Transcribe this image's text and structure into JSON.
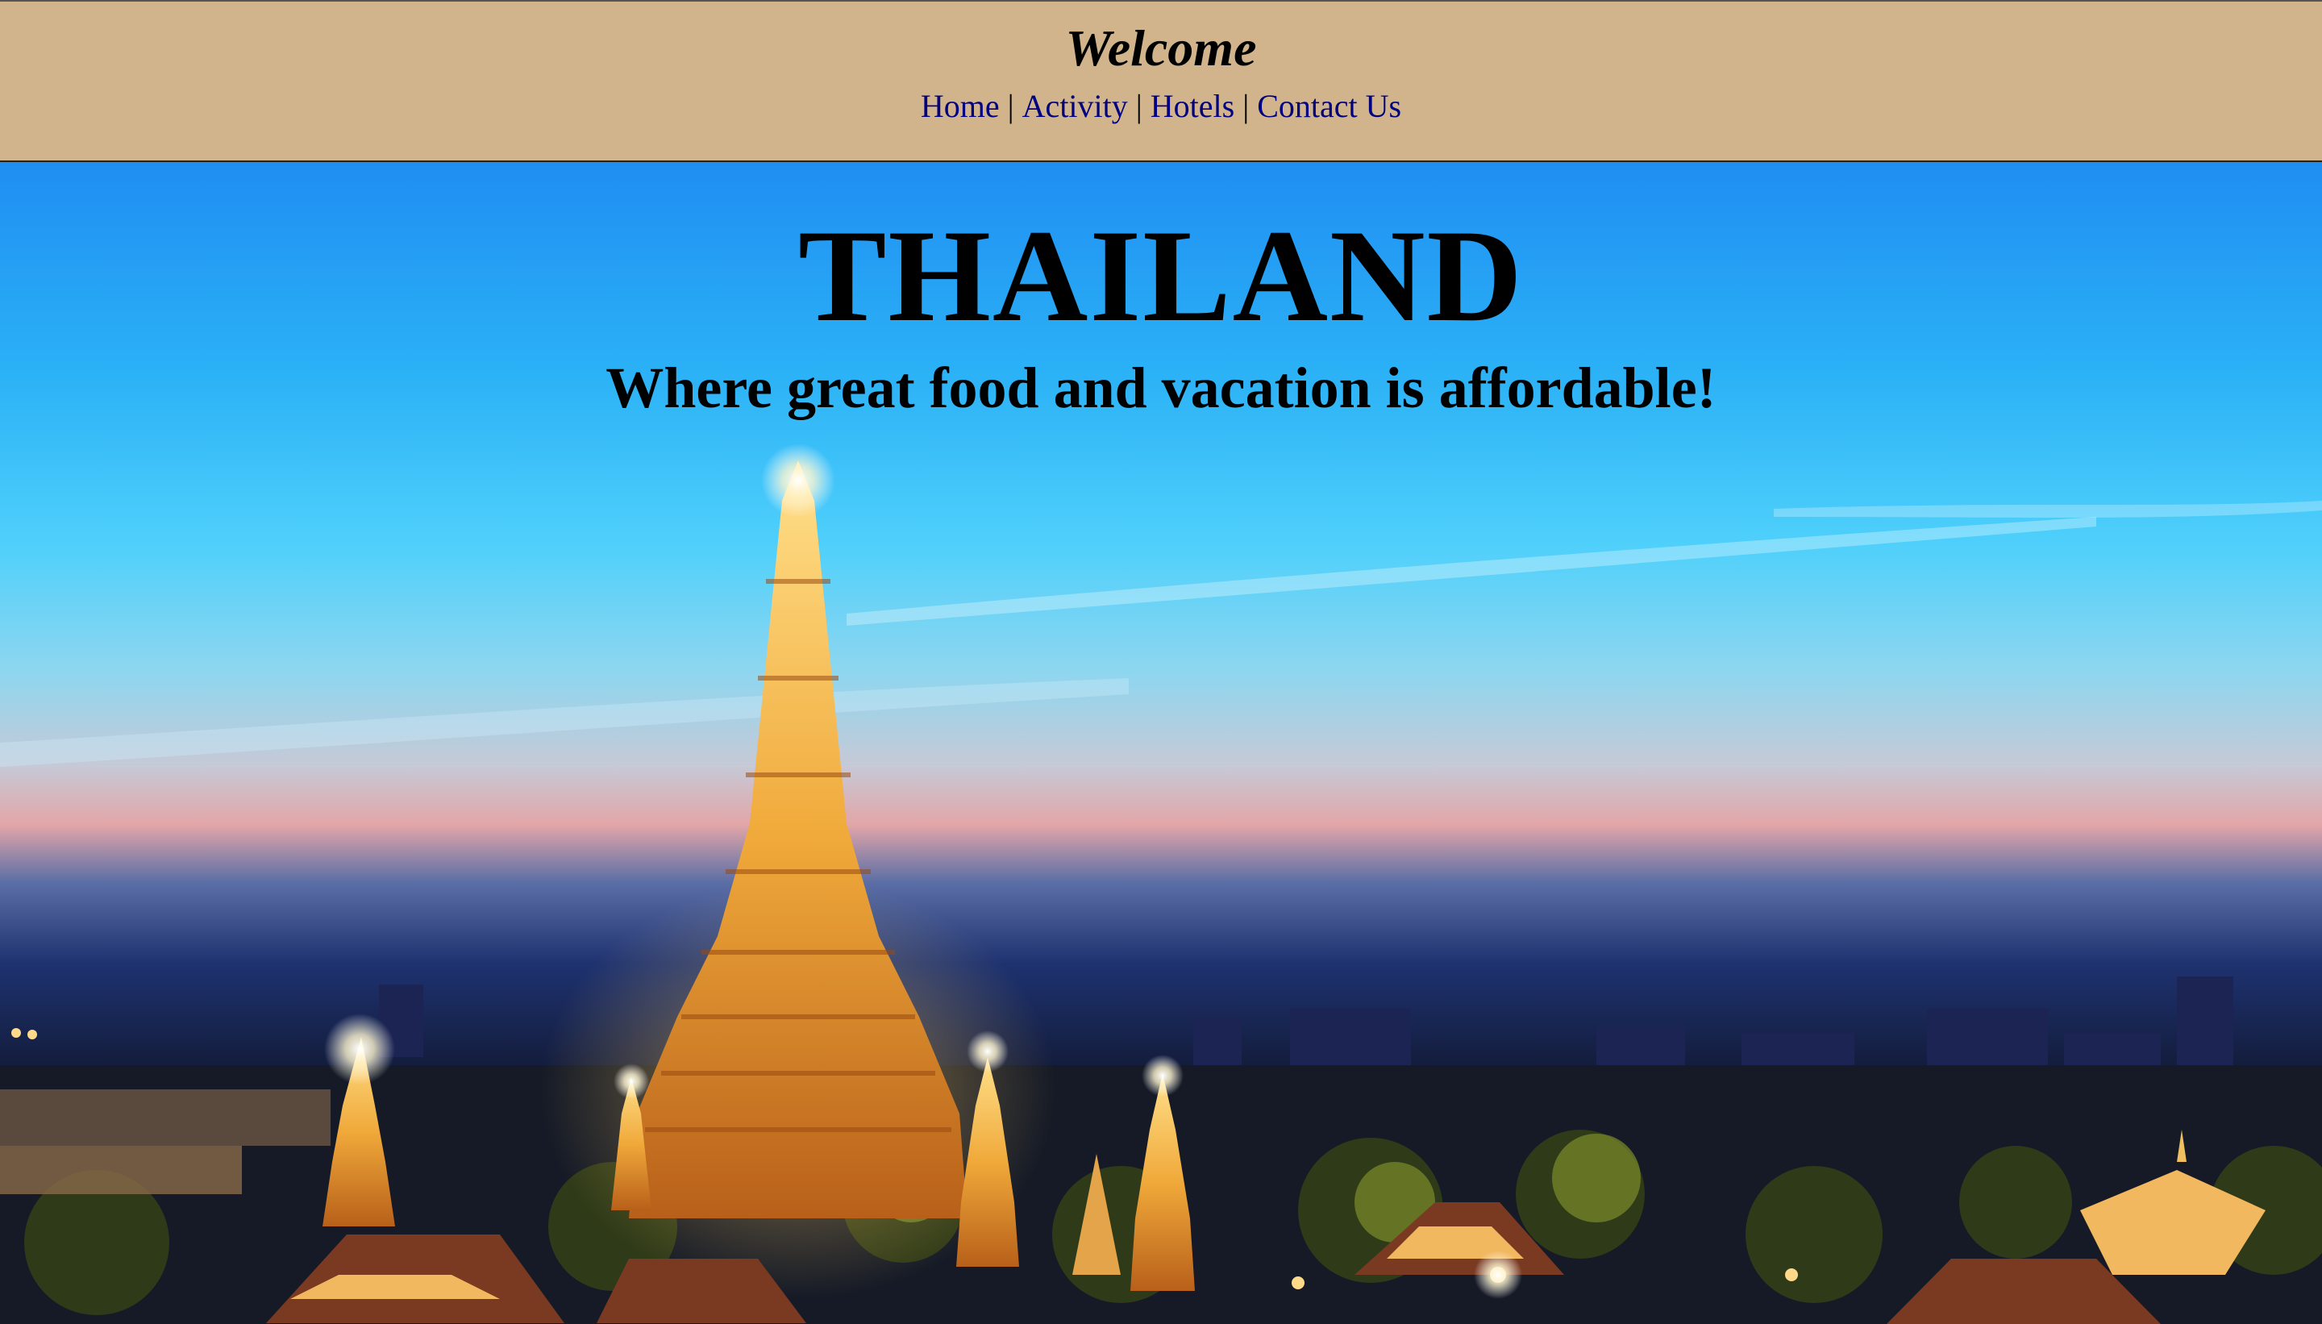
{
  "header": {
    "welcome": "Welcome",
    "nav": [
      {
        "label": "Home"
      },
      {
        "label": "Activity"
      },
      {
        "label": "Hotels"
      },
      {
        "label": "Contact Us"
      }
    ],
    "separator": "|"
  },
  "hero": {
    "title": "THAILAND",
    "subtitle": "Where great food and vacation is affordable!",
    "image_icon": "temple-skyline-photo"
  },
  "colors": {
    "header_bg": "#d2b48c",
    "nav_link": "#000080",
    "sky_top": "#1f8ef2",
    "temple_gold": "#f0a93a"
  }
}
